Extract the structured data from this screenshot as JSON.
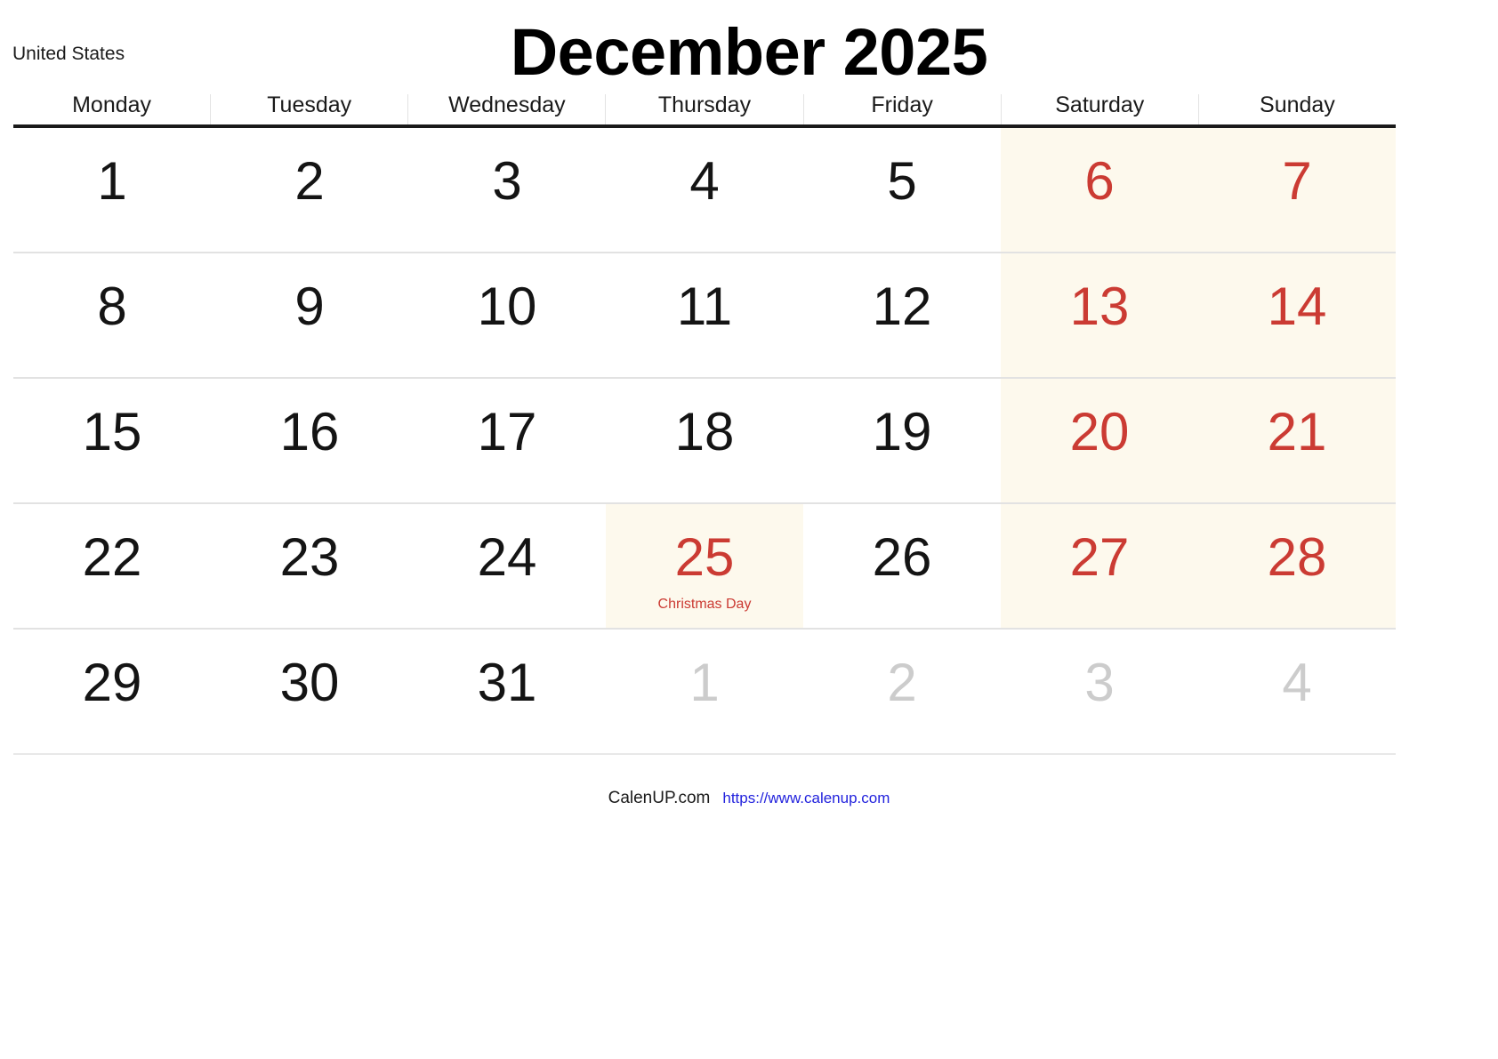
{
  "header": {
    "country": "United States",
    "title": "December 2025",
    "month": "December",
    "year": "2025"
  },
  "weekdays": [
    {
      "label": "Monday",
      "weekend": false
    },
    {
      "label": "Tuesday",
      "weekend": false
    },
    {
      "label": "Wednesday",
      "weekend": false
    },
    {
      "label": "Thursday",
      "weekend": false
    },
    {
      "label": "Friday",
      "weekend": false
    },
    {
      "label": "Saturday",
      "weekend": true
    },
    {
      "label": "Sunday",
      "weekend": true
    }
  ],
  "weeks": [
    [
      {
        "day": "1",
        "style": "normal",
        "event": "",
        "shaded": false
      },
      {
        "day": "2",
        "style": "normal",
        "event": "",
        "shaded": false
      },
      {
        "day": "3",
        "style": "normal",
        "event": "",
        "shaded": false
      },
      {
        "day": "4",
        "style": "normal",
        "event": "",
        "shaded": false
      },
      {
        "day": "5",
        "style": "normal",
        "event": "",
        "shaded": false
      },
      {
        "day": "6",
        "style": "weekend",
        "event": "",
        "shaded": true
      },
      {
        "day": "7",
        "style": "weekend",
        "event": "",
        "shaded": true
      }
    ],
    [
      {
        "day": "8",
        "style": "normal",
        "event": "",
        "shaded": false
      },
      {
        "day": "9",
        "style": "normal",
        "event": "",
        "shaded": false
      },
      {
        "day": "10",
        "style": "normal",
        "event": "",
        "shaded": false
      },
      {
        "day": "11",
        "style": "normal",
        "event": "",
        "shaded": false
      },
      {
        "day": "12",
        "style": "normal",
        "event": "",
        "shaded": false
      },
      {
        "day": "13",
        "style": "weekend",
        "event": "",
        "shaded": true
      },
      {
        "day": "14",
        "style": "weekend",
        "event": "",
        "shaded": true
      }
    ],
    [
      {
        "day": "15",
        "style": "normal",
        "event": "",
        "shaded": false
      },
      {
        "day": "16",
        "style": "normal",
        "event": "",
        "shaded": false
      },
      {
        "day": "17",
        "style": "normal",
        "event": "",
        "shaded": false
      },
      {
        "day": "18",
        "style": "normal",
        "event": "",
        "shaded": false
      },
      {
        "day": "19",
        "style": "normal",
        "event": "",
        "shaded": false
      },
      {
        "day": "20",
        "style": "weekend",
        "event": "",
        "shaded": true
      },
      {
        "day": "21",
        "style": "weekend",
        "event": "",
        "shaded": true
      }
    ],
    [
      {
        "day": "22",
        "style": "normal",
        "event": "",
        "shaded": false
      },
      {
        "day": "23",
        "style": "normal",
        "event": "",
        "shaded": false
      },
      {
        "day": "24",
        "style": "normal",
        "event": "",
        "shaded": false
      },
      {
        "day": "25",
        "style": "holiday",
        "event": "Christmas Day",
        "shaded": true
      },
      {
        "day": "26",
        "style": "normal",
        "event": "",
        "shaded": false
      },
      {
        "day": "27",
        "style": "weekend",
        "event": "",
        "shaded": true
      },
      {
        "day": "28",
        "style": "weekend",
        "event": "",
        "shaded": true
      }
    ],
    [
      {
        "day": "29",
        "style": "normal",
        "event": "",
        "shaded": false
      },
      {
        "day": "30",
        "style": "normal",
        "event": "",
        "shaded": false
      },
      {
        "day": "31",
        "style": "normal",
        "event": "",
        "shaded": false
      },
      {
        "day": "1",
        "style": "other",
        "event": "",
        "shaded": false
      },
      {
        "day": "2",
        "style": "other",
        "event": "",
        "shaded": false
      },
      {
        "day": "3",
        "style": "other",
        "event": "",
        "shaded": false
      },
      {
        "day": "4",
        "style": "other",
        "event": "",
        "shaded": false
      }
    ]
  ],
  "footer": {
    "brand": "CalenUP.com",
    "url": "https://www.calenup.com"
  },
  "colors": {
    "weekend_text": "#cb3b33",
    "holiday_text": "#cb3b33",
    "weekend_background": "#fdf9ed",
    "other_month_text": "#cccccc",
    "header_rule": "#1a1a1a",
    "row_rule": "#e2e2e2",
    "link": "#2222dd"
  }
}
